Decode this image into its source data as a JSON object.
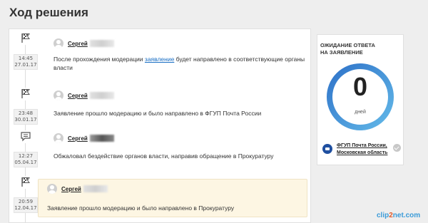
{
  "page": {
    "title": "Ход решения"
  },
  "timeline": [
    {
      "icon": "flag-icon",
      "time": "14:45",
      "date": "27.01.17",
      "author": "Сергей",
      "text_before": "После прохождения модерации ",
      "link": "заявление",
      "text_after": " будет направлено в соответствующие органы власти"
    },
    {
      "icon": "flag-icon",
      "time": "23:48",
      "date": "30.01.17",
      "author": "Сергей",
      "text": "Заявление прошло модерацию и было направлено в ФГУП Почта России"
    },
    {
      "icon": "comment-icon",
      "time": "12:27",
      "date": "05.04.17",
      "author": "Сергей",
      "text": "Обжаловал бездействие органов власти, направив обращение в Прокуратуру"
    },
    {
      "icon": "flag-icon",
      "time": "20:59",
      "date": "12.04.17",
      "author": "Сергей",
      "text": "Заявление прошло модерацию и было направлено в Прокуратуру"
    }
  ],
  "sidebar": {
    "title_line1": "ОЖИДАНИЕ ОТВЕТА",
    "title_line2": "НА ЗАЯВЛЕНИЕ",
    "days_value": "0",
    "days_unit": "дней",
    "org_line1": "ФГУП Почта России,",
    "org_line2": "Московская область"
  },
  "watermark": {
    "part1": "clip",
    "part2": "2",
    "part3": "net.com"
  },
  "colors": {
    "gauge_dark": "#2f73c9",
    "gauge_light": "#62b8e8",
    "link": "#1a6fc4",
    "highlight": "#fdf6e3"
  }
}
